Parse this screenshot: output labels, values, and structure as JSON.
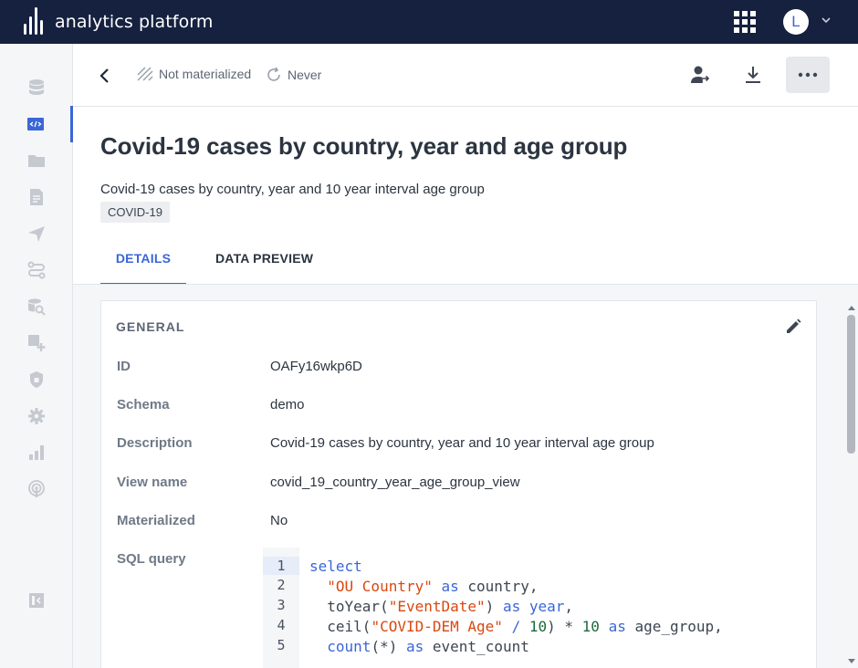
{
  "app": {
    "name": "analytics platform",
    "user_initial": "L"
  },
  "header": {
    "materialized_status": "Not materialized",
    "refresh_status": "Never",
    "icons": [
      "back-arrow-icon",
      "stripes-icon",
      "refresh-icon",
      "share-user-icon",
      "download-icon",
      "more-horizontal-icon"
    ]
  },
  "sidebar": {
    "items": [
      {
        "name": "datasets",
        "icon": "database-icon",
        "active": false
      },
      {
        "name": "sql-views",
        "icon": "code-window-icon",
        "active": true
      },
      {
        "name": "folders",
        "icon": "folder-icon",
        "active": false
      },
      {
        "name": "reports",
        "icon": "report-icon",
        "active": false
      },
      {
        "name": "publish",
        "icon": "send-icon",
        "active": false
      },
      {
        "name": "pipelines",
        "icon": "route-icon",
        "active": false
      },
      {
        "name": "data-explorer",
        "icon": "database-search-icon",
        "active": false
      },
      {
        "name": "add-widget",
        "icon": "add-widget-icon",
        "active": false
      },
      {
        "name": "security",
        "icon": "shield-icon",
        "active": false
      },
      {
        "name": "settings",
        "icon": "gear-icon",
        "active": false
      },
      {
        "name": "analytics",
        "icon": "bar-chart-icon",
        "active": false
      },
      {
        "name": "broadcast",
        "icon": "podcast-icon",
        "active": false
      },
      {
        "name": "collapse",
        "icon": "sidebar-collapse-icon",
        "active": false
      }
    ]
  },
  "page": {
    "title": "Covid-19 cases by country, year and age group",
    "subtitle": "Covid-19 cases by country, year and 10 year interval age group",
    "tag": "COVID-19",
    "tabs": [
      {
        "label": "DETAILS",
        "active": true
      },
      {
        "label": "DATA PREVIEW",
        "active": false
      }
    ]
  },
  "general": {
    "section_title": "GENERAL",
    "rows": [
      {
        "label": "ID",
        "value": "OAFy16wkp6D"
      },
      {
        "label": "Schema",
        "value": "demo"
      },
      {
        "label": "Description",
        "value": "Covid-19 cases by country, year and 10 year interval age group"
      },
      {
        "label": "View name",
        "value": "covid_19_country_year_age_group_view"
      },
      {
        "label": "Materialized",
        "value": "No"
      },
      {
        "label": "SQL query",
        "value": ""
      }
    ],
    "sql": {
      "line_numbers": [
        "1",
        "2",
        "3",
        "4",
        "5"
      ],
      "l1_kw": "select",
      "l2_str": "\"OU Country\"",
      "l2_as": "as",
      "l2_rest": "country,",
      "l3_fn": "toYear(",
      "l3_str": "\"EventDate\"",
      "l3_close": ")",
      "l3_as": "as",
      "l3_alias": "year",
      "l3_comma": ",",
      "l4_fn": "ceil(",
      "l4_str": "\"COVID-DEM Age\"",
      "l4_op": "/",
      "l4_n1": "10",
      "l4_mid": ") *",
      "l4_n2": "10",
      "l4_as": "as",
      "l4_rest": "age_group,",
      "l5_fn": "count",
      "l5_args": "(*)",
      "l5_as": "as",
      "l5_rest": "event_count"
    }
  },
  "colors": {
    "topbar": "#15213f",
    "accent": "#3a66d8",
    "string": "#d9480f",
    "number": "#1a6a3a"
  }
}
